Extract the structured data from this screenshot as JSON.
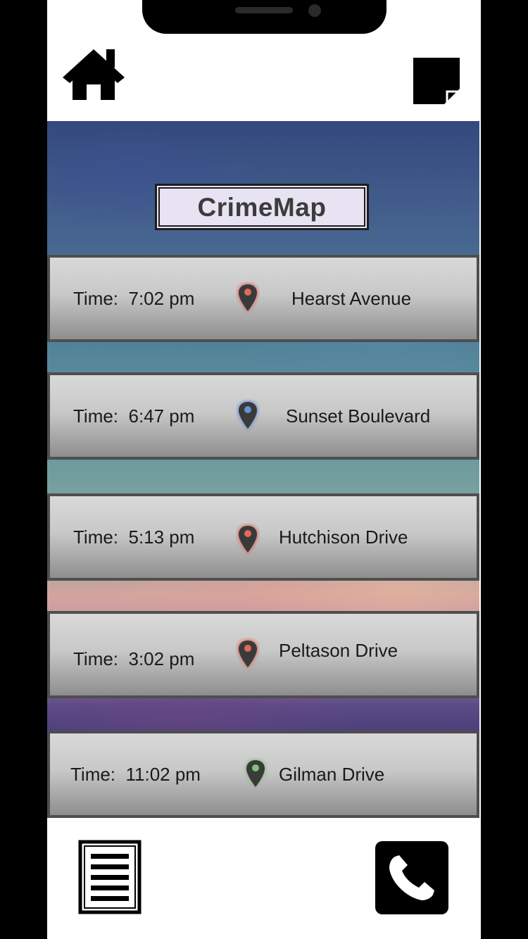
{
  "app": {
    "title": "CrimeMap"
  },
  "header": {
    "home_icon": "home-icon",
    "note_icon": "sticky-note-icon"
  },
  "footer": {
    "list_icon": "list-icon",
    "phone_icon": "phone-icon"
  },
  "incidents": [
    {
      "time": "Time:  7:02 pm",
      "street": "Hearst Avenue",
      "pin_color": "#e06a5a"
    },
    {
      "time": "Time:  6:47 pm",
      "street": "Sunset Boulevard",
      "pin_color": "#6a8fd6"
    },
    {
      "time": "Time:  5:13 pm",
      "street": "Hutchison Drive",
      "pin_color": "#e06a5a"
    },
    {
      "time": "Time:  3:02 pm",
      "street": "Peltason Drive",
      "pin_color": "#e06a5a"
    },
    {
      "time": "Time:  11:02 pm",
      "street": "Gilman Drive",
      "pin_color": "#7fc27a"
    }
  ]
}
